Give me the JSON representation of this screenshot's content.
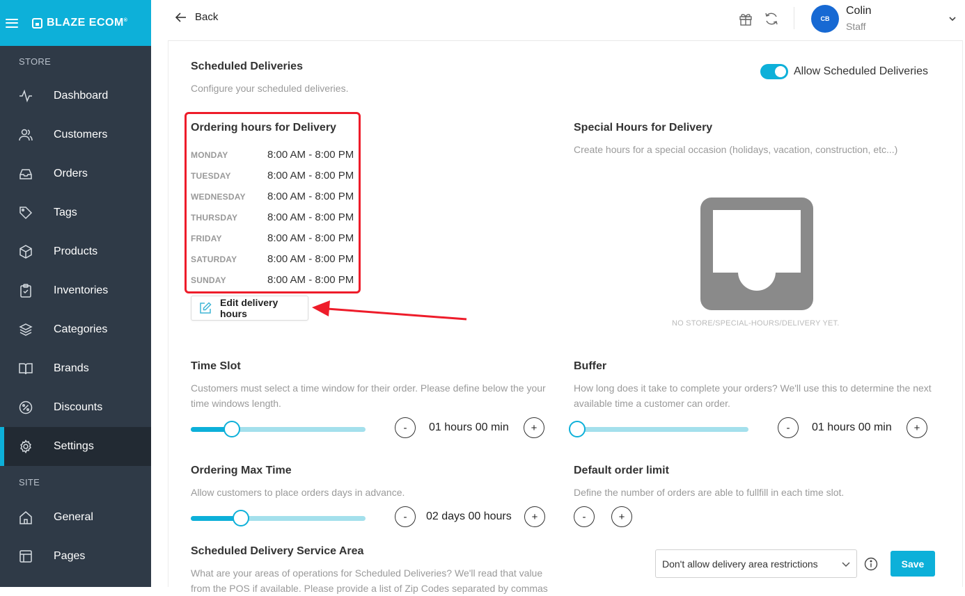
{
  "sidebar": {
    "brand": "BLAZE ECOM",
    "section_store": "STORE",
    "section_site": "SITE",
    "items": [
      {
        "label": "Dashboard"
      },
      {
        "label": "Customers"
      },
      {
        "label": "Orders"
      },
      {
        "label": "Tags"
      },
      {
        "label": "Products"
      },
      {
        "label": "Inventories"
      },
      {
        "label": "Categories"
      },
      {
        "label": "Brands"
      },
      {
        "label": "Discounts"
      },
      {
        "label": "Settings",
        "active": true
      }
    ],
    "site_items": [
      {
        "label": "General"
      },
      {
        "label": "Pages"
      }
    ]
  },
  "header": {
    "back_label": "Back",
    "user": {
      "initials": "CB",
      "name": "Colin",
      "role": "Staff"
    }
  },
  "scheduled": {
    "title": "Scheduled Deliveries",
    "subtitle": "Configure your scheduled deliveries.",
    "toggle_label": "Allow Scheduled Deliveries",
    "toggle_on": true
  },
  "ordering_hours": {
    "title": "Ordering hours for Delivery",
    "days": [
      {
        "day": "MONDAY",
        "hours": "8:00 AM - 8:00 PM"
      },
      {
        "day": "TUESDAY",
        "hours": "8:00 AM - 8:00 PM"
      },
      {
        "day": "WEDNESDAY",
        "hours": "8:00 AM - 8:00 PM"
      },
      {
        "day": "THURSDAY",
        "hours": "8:00 AM - 8:00 PM"
      },
      {
        "day": "FRIDAY",
        "hours": "8:00 AM - 8:00 PM"
      },
      {
        "day": "SATURDAY",
        "hours": "8:00 AM - 8:00 PM"
      },
      {
        "day": "SUNDAY",
        "hours": "8:00 AM - 8:00 PM"
      }
    ],
    "edit_label": "Edit delivery hours"
  },
  "special_hours": {
    "title": "Special Hours for Delivery",
    "subtitle": "Create hours for a special occasion (holidays, vacation, construction, etc...)",
    "empty_text": "NO STORE/SPECIAL-HOURS/DELIVERY YET."
  },
  "time_slot": {
    "title": "Time Slot",
    "subtitle_1": "Customers must select a time window for their order. Please define below the your",
    "subtitle_2": "time windows length.",
    "value": "01 hours 00 min",
    "minus": "-",
    "plus": "+",
    "slider_fraction": 0.24
  },
  "buffer": {
    "title": "Buffer",
    "subtitle_1": "How long does it take to complete your orders? We'll use this to determine the next",
    "subtitle_2": "available time a customer can order.",
    "value": "01 hours 00 min",
    "minus": "-",
    "plus": "+",
    "slider_fraction": 0.0
  },
  "max_time": {
    "title": "Ordering Max Time",
    "subtitle": "Allow customers to place orders days in advance.",
    "value": "02 days 00 hours",
    "minus": "-",
    "plus": "+",
    "slider_fraction": 0.29
  },
  "order_limit": {
    "title": "Default order limit",
    "subtitle": "Define the number of orders are able to fullfill in each time slot.",
    "minus": "-",
    "plus": "+"
  },
  "service_area": {
    "title": "Scheduled Delivery Service Area",
    "subtitle_1": "What are your areas of operations for Scheduled Deliveries? We'll read that value",
    "subtitle_2": "from the POS if available. Please provide a list of Zip Codes separated by commas",
    "select_value": "Don't allow delivery area restrictions",
    "save_label": "Save"
  },
  "colors": {
    "accent": "#0db0d9",
    "sidebar": "#2f3a47",
    "highlight": "#ee1c2a"
  }
}
